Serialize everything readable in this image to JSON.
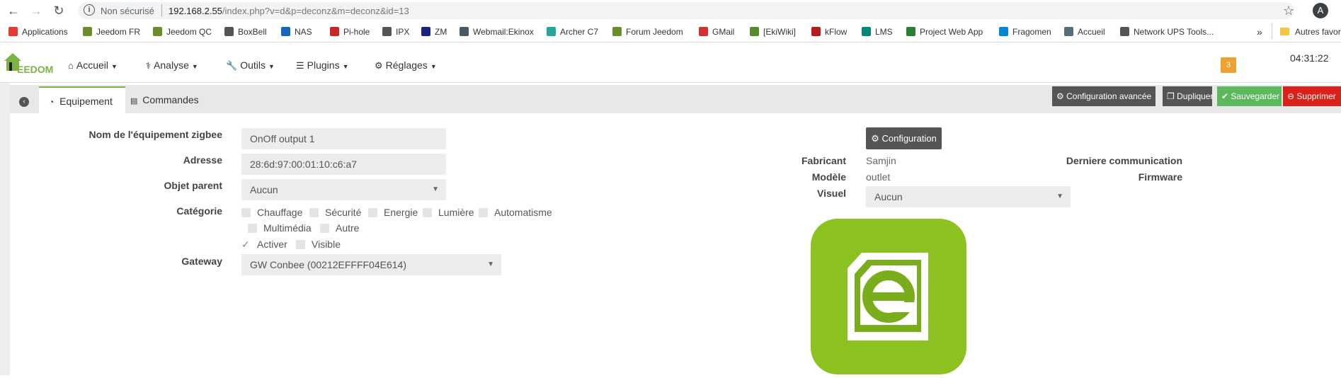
{
  "browser": {
    "security_label": "Non sécurisé",
    "url_host": "192.168.2.55",
    "url_path": "/index.php?v=d&p=deconz&m=deconz&id=13",
    "avatar_letter": "A",
    "bookmarks": [
      {
        "label": "Applications",
        "color": "#e53935"
      },
      {
        "label": "Jeedom FR",
        "color": "#6a8f2a"
      },
      {
        "label": "Jeedom QC",
        "color": "#6a8f2a"
      },
      {
        "label": "BoxBell",
        "color": "#555555"
      },
      {
        "label": "NAS",
        "color": "#1565c0"
      },
      {
        "label": "Pi-hole",
        "color": "#c62828"
      },
      {
        "label": "IPX",
        "color": "#555555"
      },
      {
        "label": "ZM",
        "color": "#1a237e"
      },
      {
        "label": "Webmail:Ekinox",
        "color": "#455a64"
      },
      {
        "label": "Archer C7",
        "color": "#26a69a"
      },
      {
        "label": "Forum Jeedom",
        "color": "#6a8f2a"
      },
      {
        "label": "GMail",
        "color": "#d32f2f"
      },
      {
        "label": "[EkiWiki]",
        "color": "#558b2f"
      },
      {
        "label": "kFlow",
        "color": "#b71c1c"
      },
      {
        "label": "LMS",
        "color": "#00897b"
      },
      {
        "label": "Project Web App",
        "color": "#2e7d32"
      },
      {
        "label": "Fragomen",
        "color": "#0288d1"
      },
      {
        "label": "Accueil",
        "color": "#546e7a"
      },
      {
        "label": "Network UPS Tools...",
        "color": "#555555"
      }
    ],
    "more_label": "»",
    "other_bookmarks": "Autres favoris"
  },
  "header": {
    "logo_text": "EEDOM",
    "menus": [
      {
        "label": "Accueil",
        "icon": "home-icon"
      },
      {
        "label": "Analyse",
        "icon": "stethoscope-icon"
      },
      {
        "label": "Outils",
        "icon": "wrench-icon"
      },
      {
        "label": "Plugins",
        "icon": "list-icon"
      },
      {
        "label": "Réglages",
        "icon": "gears-icon"
      }
    ],
    "notification_count": "3",
    "time": "04:31:22"
  },
  "tabs": [
    {
      "label": "Equipement",
      "icon": "dashboard-icon"
    },
    {
      "label": "Commandes",
      "icon": "list-alt-icon"
    }
  ],
  "actions": {
    "advanced_config": "Configuration avancée",
    "duplicate": "Dupliquer",
    "save": "Sauvegarder",
    "delete": "Supprimer",
    "colors": {
      "dark": "#555555",
      "save": "#5cb85c",
      "delete": "#d9221a"
    }
  },
  "form": {
    "name_label": "Nom de l'équipement zigbee",
    "name_value": "OnOff output 1",
    "address_label": "Adresse",
    "address_value": "28:6d:97:00:01:10:c6:a7",
    "parent_label": "Objet parent",
    "parent_value": "Aucun",
    "category_label": "Catégorie",
    "categories": [
      "Chauffage",
      "Sécurité",
      "Energie",
      "Lumière",
      "Automatisme",
      "Multimédia",
      "Autre"
    ],
    "activate_label": "Activer",
    "visible_label": "Visible",
    "gateway_label": "Gateway",
    "gateway_value": "GW Conbee (00212EFFFF04E614)"
  },
  "info": {
    "config_button": "Configuration",
    "manufacturer_label": "Fabricant",
    "manufacturer_value": "Samjin",
    "model_label": "Modèle",
    "model_value": "outlet",
    "visual_label": "Visuel",
    "visual_value": "Aucun",
    "last_comm_label": "Derniere communication",
    "firmware_label": "Firmware"
  }
}
